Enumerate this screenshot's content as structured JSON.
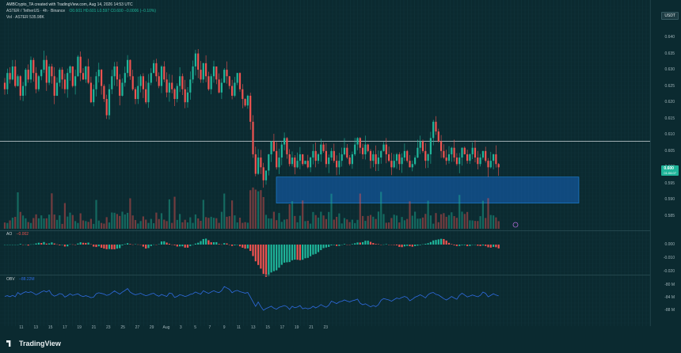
{
  "header": {
    "author_line": "AMBCrypto_TA created with TradingView.com, Aug 14, 2026 14:53 UTC",
    "symbol_line": "ASTER / TetherUS · 4h · Binance",
    "ohlc": "O0.601 H0.601 L0.597 C0.600 −0.0006 (−0.10%)",
    "vol_line": "Vol · ASTER  535.98K",
    "currency_button": "USDT"
  },
  "price_axis": {
    "labels": [
      "0.640",
      "0.635",
      "0.630",
      "0.625",
      "0.620",
      "0.615",
      "0.610",
      "0.605",
      "0.600",
      "0.595",
      "0.590",
      "0.585"
    ],
    "current_price": "0.600",
    "current_countdown": "01:06:07",
    "ao_labels": [
      "0.000",
      "-0.010",
      "-0.020"
    ],
    "obv_labels": [
      "-80 M",
      "-84 M",
      "-88 M"
    ]
  },
  "time_axis": {
    "labels": [
      "11",
      "13",
      "15",
      "17",
      "19",
      "21",
      "23",
      "25",
      "27",
      "29",
      "Aug",
      "3",
      "5",
      "7",
      "9",
      "11",
      "13",
      "15",
      "17",
      "19",
      "21",
      "23"
    ]
  },
  "ao_panel": {
    "label": "AO",
    "value": "−0.002"
  },
  "obv_panel": {
    "label": "OBV",
    "value": "−88.22M"
  },
  "horizontal_level": "0.608",
  "demand_zone": {
    "top": "0.597",
    "bottom": "0.589"
  },
  "colors": {
    "up": "#1fb59a",
    "down": "#ef5350",
    "zone": "#1565c0",
    "obv": "#2f6be0",
    "bg": "#0b2a30"
  },
  "brand": "TradingView",
  "chart_data": {
    "type": "candlestick",
    "title": "ASTER / TetherUS · 4h · Binance",
    "ylim": [
      0.583,
      0.645
    ],
    "note": "approximate closes per 4h candle, reconstructed",
    "closes": [
      0.624,
      0.629,
      0.627,
      0.631,
      0.625,
      0.628,
      0.622,
      0.625,
      0.63,
      0.627,
      0.633,
      0.629,
      0.624,
      0.628,
      0.63,
      0.633,
      0.626,
      0.631,
      0.628,
      0.622,
      0.626,
      0.63,
      0.627,
      0.624,
      0.629,
      0.631,
      0.625,
      0.628,
      0.634,
      0.629,
      0.627,
      0.631,
      0.626,
      0.62,
      0.624,
      0.628,
      0.63,
      0.625,
      0.621,
      0.616,
      0.624,
      0.628,
      0.631,
      0.627,
      0.622,
      0.626,
      0.629,
      0.633,
      0.628,
      0.624,
      0.621,
      0.625,
      0.628,
      0.624,
      0.62,
      0.626,
      0.629,
      0.632,
      0.628,
      0.625,
      0.631,
      0.627,
      0.623,
      0.626,
      0.624,
      0.621,
      0.625,
      0.628,
      0.624,
      0.62,
      0.623,
      0.627,
      0.631,
      0.635,
      0.63,
      0.627,
      0.632,
      0.628,
      0.624,
      0.628,
      0.631,
      0.627,
      0.623,
      0.626,
      0.63,
      0.628,
      0.625,
      0.622,
      0.626,
      0.629,
      0.624,
      0.621,
      0.619,
      0.622,
      0.614,
      0.604,
      0.598,
      0.603,
      0.6,
      0.596,
      0.599,
      0.604,
      0.608,
      0.605,
      0.6,
      0.603,
      0.607,
      0.609,
      0.604,
      0.601,
      0.603,
      0.6,
      0.602,
      0.604,
      0.601,
      0.602,
      0.6,
      0.603,
      0.605,
      0.602,
      0.604,
      0.607,
      0.605,
      0.601,
      0.603,
      0.605,
      0.602,
      0.6,
      0.602,
      0.604,
      0.606,
      0.603,
      0.601,
      0.604,
      0.607,
      0.609,
      0.606,
      0.604,
      0.607,
      0.605,
      0.602,
      0.604,
      0.601,
      0.603,
      0.605,
      0.607,
      0.604,
      0.602,
      0.6,
      0.602,
      0.604,
      0.601,
      0.603,
      0.605,
      0.602,
      0.6,
      0.601,
      0.603,
      0.606,
      0.608,
      0.605,
      0.602,
      0.604,
      0.609,
      0.614,
      0.611,
      0.608,
      0.605,
      0.603,
      0.602,
      0.604,
      0.606,
      0.603,
      0.601,
      0.603,
      0.606,
      0.604,
      0.602,
      0.604,
      0.606,
      0.603,
      0.601,
      0.603,
      0.605,
      0.602,
      0.6,
      0.602,
      0.604,
      0.601,
      0.6
    ]
  }
}
